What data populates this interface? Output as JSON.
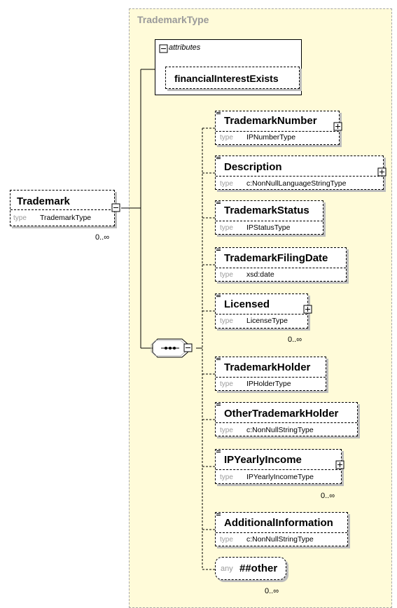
{
  "complex_type": {
    "title": "TrademarkType"
  },
  "root": {
    "name": "Trademark",
    "type_key": "type",
    "type": "TrademarkType",
    "occurrence": "0..∞",
    "toggle_icon": "collapse-icon"
  },
  "attributes": {
    "label": "attributes",
    "toggle_icon": "collapse-icon",
    "items": [
      {
        "name": "financialInterestExists"
      }
    ]
  },
  "sequence": {
    "icon": "sequence-compositor-icon",
    "toggle_icon": "collapse-icon"
  },
  "elements": [
    {
      "name": "TrademarkNumber",
      "type_key": "type",
      "type": "IPNumberType",
      "occurrence": "",
      "expandable": true
    },
    {
      "name": "Description",
      "type_key": "type",
      "type": "c:NonNullLanguageStringType",
      "occurrence": "",
      "expandable": true
    },
    {
      "name": "TrademarkStatus",
      "type_key": "type",
      "type": "IPStatusType",
      "occurrence": "",
      "expandable": false
    },
    {
      "name": "TrademarkFilingDate",
      "type_key": "type",
      "type": "xsd:date",
      "occurrence": "",
      "expandable": false
    },
    {
      "name": "Licensed",
      "type_key": "type",
      "type": "LicenseType",
      "occurrence": "0..∞",
      "expandable": true
    },
    {
      "name": "TrademarkHolder",
      "type_key": "type",
      "type": "IPHolderType",
      "occurrence": "",
      "expandable": false
    },
    {
      "name": "OtherTrademarkHolder",
      "type_key": "type",
      "type": "c:NonNullStringType",
      "occurrence": "",
      "expandable": false
    },
    {
      "name": "IPYearlyIncome",
      "type_key": "type",
      "type": "IPYearlyIncomeType",
      "occurrence": "0..∞",
      "expandable": true
    },
    {
      "name": "AdditionalInformation",
      "type_key": "type",
      "type": "c:NonNullStringType",
      "occurrence": "",
      "expandable": false
    }
  ],
  "any": {
    "key": "any",
    "namespace": "##other",
    "occurrence": "0..∞"
  },
  "colors": {
    "panel_bg": "#fffbd9",
    "title": "#9a9a9a",
    "shadow": "#bdbdbd"
  }
}
